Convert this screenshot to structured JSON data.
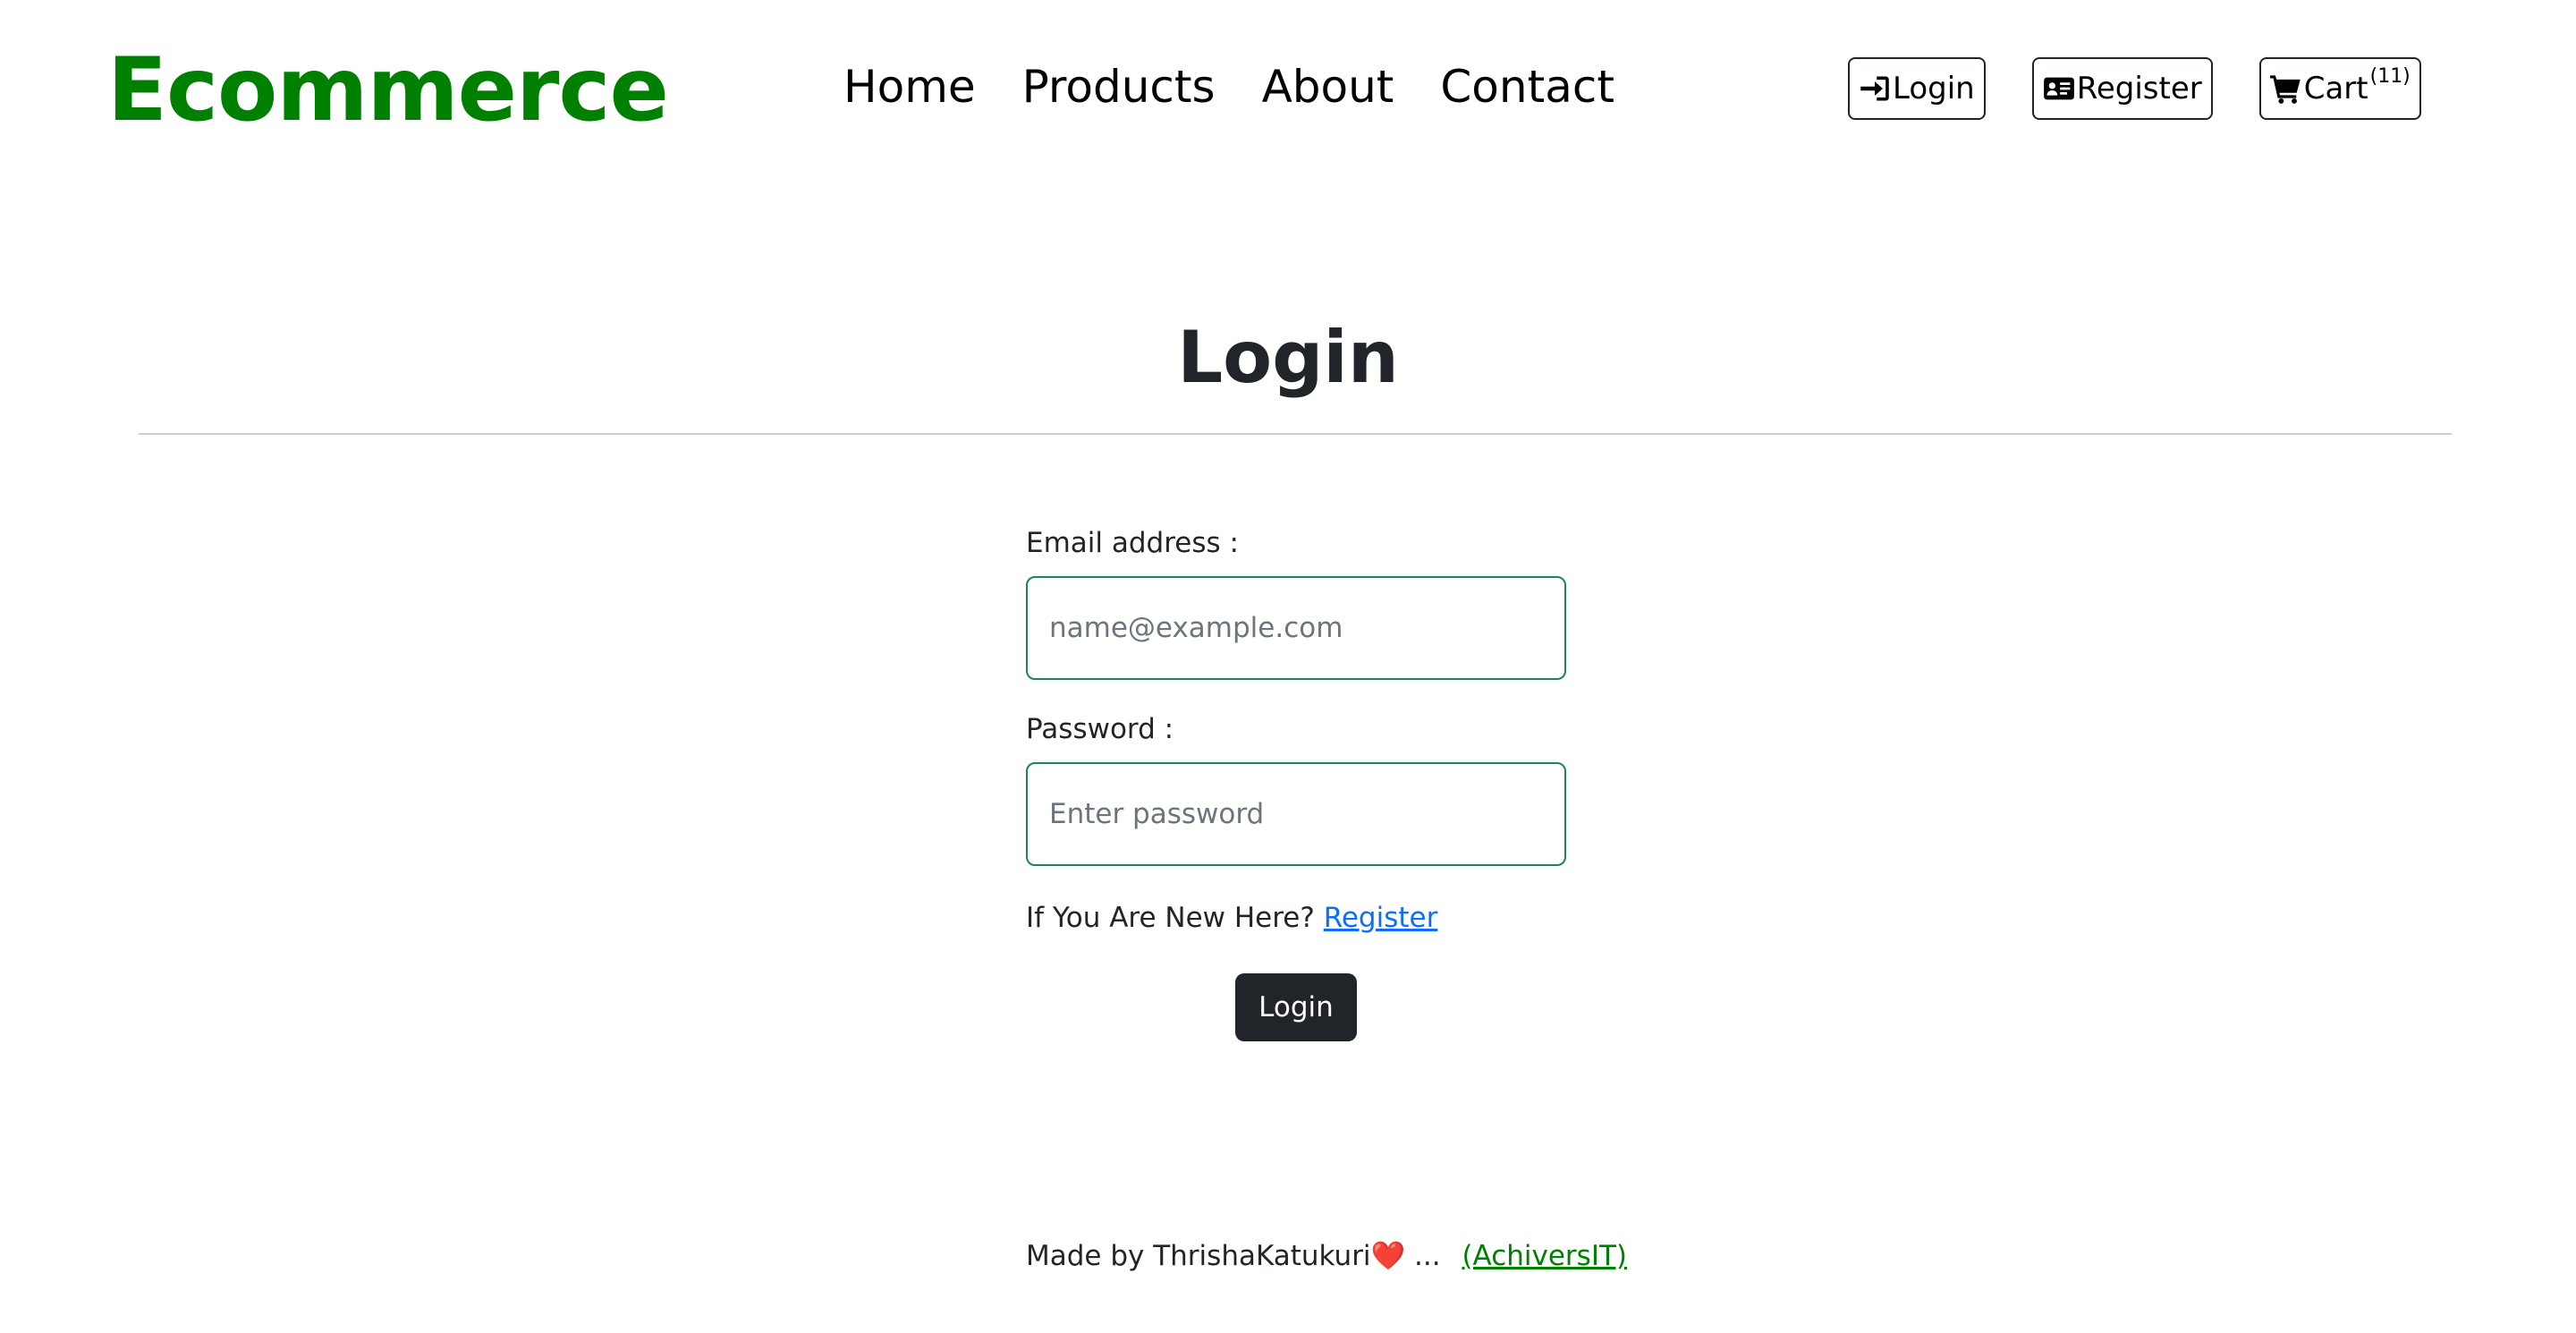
{
  "navbar": {
    "brand": "Ecommerce",
    "links": [
      {
        "label": "Home"
      },
      {
        "label": "Products"
      },
      {
        "label": "About"
      },
      {
        "label": "Contact"
      }
    ],
    "actions": {
      "login_label": "Login",
      "login_icon": "sign-in-icon",
      "register_label": "Register",
      "register_icon": "id-card-icon",
      "cart_label": "Cart",
      "cart_icon": "shopping-cart-icon",
      "cart_count": "(11)"
    }
  },
  "main": {
    "title": "Login",
    "form": {
      "email_label": "Email address :",
      "email_placeholder": "name@example.com",
      "email_value": "",
      "password_label": "Password :",
      "password_placeholder": "Enter password",
      "password_value": "",
      "register_prompt": "If You Are New Here?",
      "register_link": "Register",
      "submit_label": "Login"
    }
  },
  "footer": {
    "made_by": "Made by ThrishaKatukuri",
    "heart": "❤️",
    "ellipsis": "...",
    "link_text": "(AchiversIT)"
  },
  "colors": {
    "brand": "#008000",
    "input_border": "#198754",
    "link": "#0d6efd",
    "button_dark": "#212529"
  }
}
